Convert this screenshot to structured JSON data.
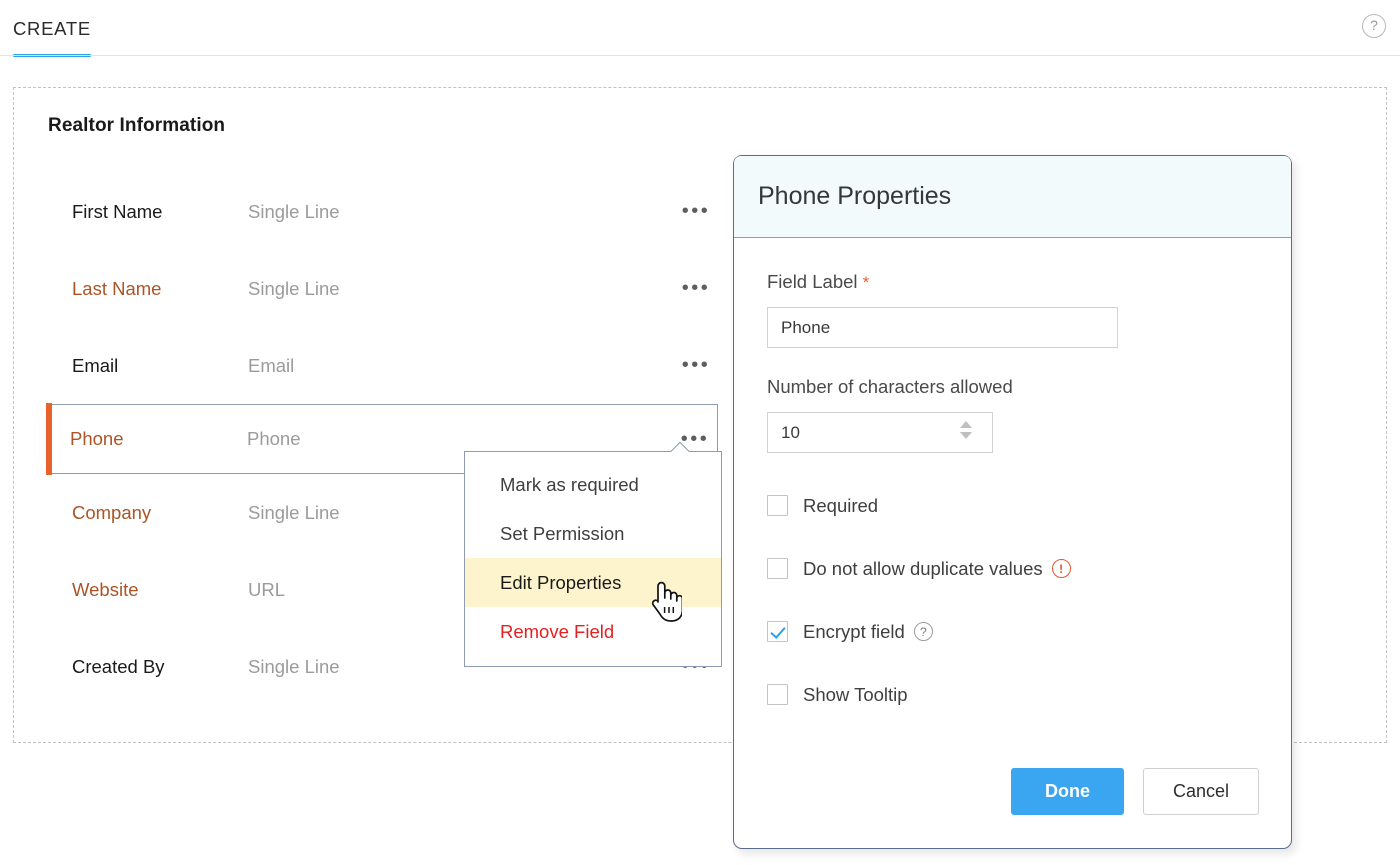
{
  "header": {
    "tabs": [
      {
        "label": "CREATE",
        "active": true
      }
    ],
    "help_icon": "question-mark-circle-icon"
  },
  "form": {
    "section_title": "Realtor Information",
    "row_menu_icon": "ellipsis-icon",
    "fields": [
      {
        "label": "First Name",
        "type": "Single Line",
        "accent": false,
        "selected": false
      },
      {
        "label": "Last Name",
        "type": "Single Line",
        "accent": true,
        "selected": false
      },
      {
        "label": "Email",
        "type": "Email",
        "accent": false,
        "selected": false
      },
      {
        "label": "Phone",
        "type": "Phone",
        "accent": true,
        "selected": true
      },
      {
        "label": "Company",
        "type": "Single Line",
        "accent": true,
        "selected": false
      },
      {
        "label": "Website",
        "type": "URL",
        "accent": true,
        "selected": false
      },
      {
        "label": "Created By",
        "type": "Single Line",
        "accent": false,
        "selected": false
      }
    ]
  },
  "context_menu": {
    "items": [
      {
        "label": "Mark as required",
        "state": "normal"
      },
      {
        "label": "Set Permission",
        "state": "normal"
      },
      {
        "label": "Edit Properties",
        "state": "highlighted"
      },
      {
        "label": "Remove Field",
        "state": "danger"
      }
    ],
    "cursor_icon": "pointing-hand-cursor"
  },
  "dialog": {
    "title": "Phone Properties",
    "field_label": {
      "label": "Field Label",
      "required_marker": "*",
      "value": "Phone",
      "placeholder": "Phone"
    },
    "char_limit": {
      "label": "Number of characters allowed",
      "value": "10",
      "spinner_icon": "stepper-arrows-icon"
    },
    "options": [
      {
        "label": "Required",
        "checked": false,
        "icon": null
      },
      {
        "label": "Do not allow duplicate values",
        "checked": false,
        "icon": "warning-circle-icon",
        "icon_glyph": "!"
      },
      {
        "label": "Encrypt field",
        "checked": true,
        "icon": "help-circle-icon",
        "icon_glyph": "?"
      },
      {
        "label": "Show Tooltip",
        "checked": false,
        "icon": null
      }
    ],
    "buttons": {
      "primary": "Done",
      "secondary": "Cancel"
    }
  },
  "colors": {
    "accent_blue": "#3aa5f0",
    "tab_underline": "#30a3e6",
    "field_accent": "#ab5526",
    "selected_bar": "#e8622c",
    "danger_red": "#e52020",
    "highlight_yellow": "#fdf4cd",
    "dialog_border": "#5b6b8a",
    "dialog_header_bg": "#f2fafc"
  }
}
